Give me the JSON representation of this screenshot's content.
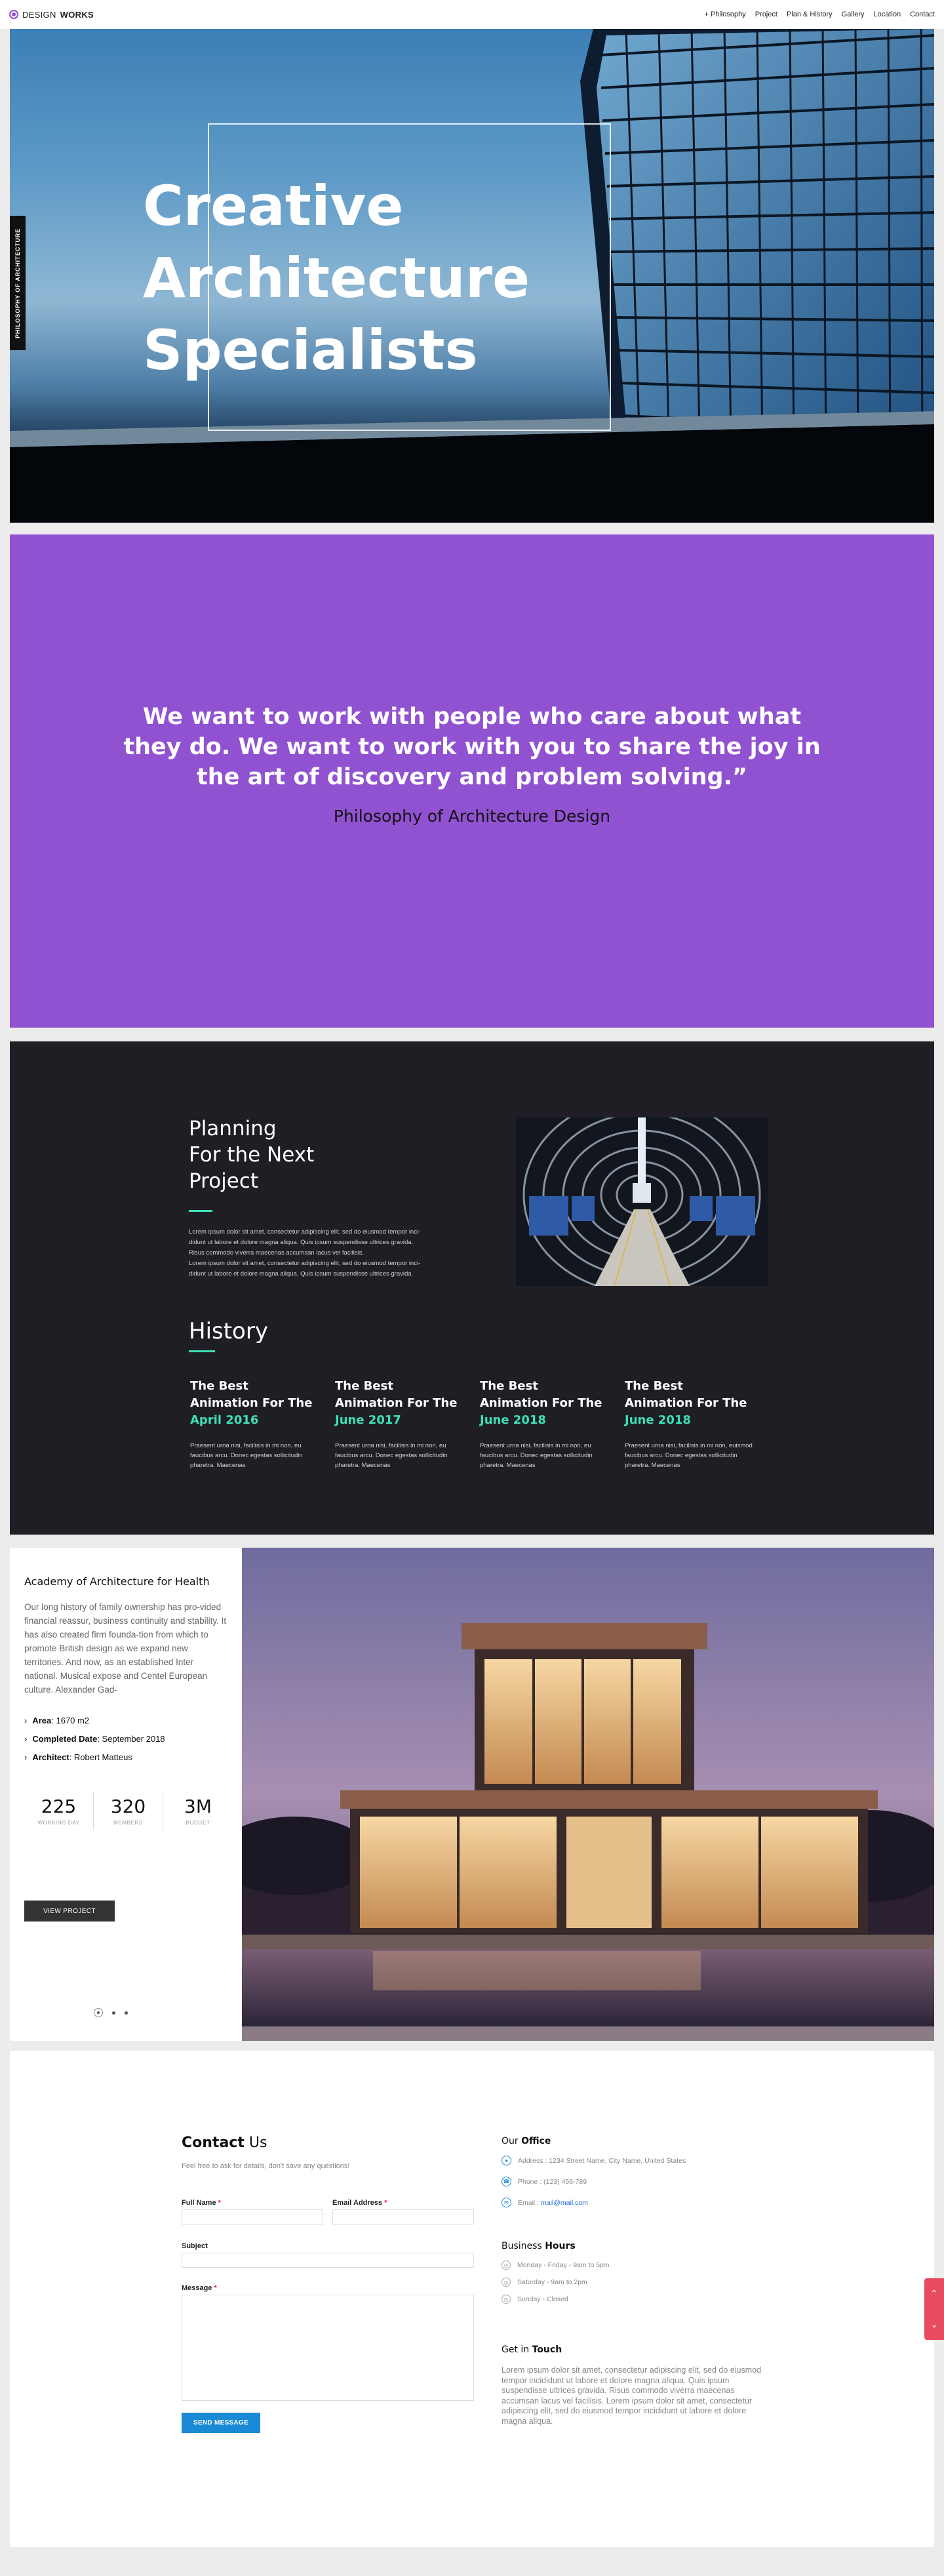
{
  "header": {
    "logo_light": "DESIGN",
    "logo_bold": "WORKS",
    "nav": [
      "+ Philosophy",
      "Project",
      "Plan & History",
      "Gallery",
      "Location",
      "Contact"
    ]
  },
  "hero": {
    "title": "Creative Architecture Specialists",
    "side_label": "PHILOSOPHY OF ARCHITECTURE"
  },
  "quote": {
    "text": "We want to work with people who care about what they do. We want to work with you to share the joy in the art of discovery and problem solving.”",
    "attribution": "Philosophy of Architecture Design"
  },
  "planning": {
    "title": "Planning\nFor the Next\nProject",
    "body": "Lorem ipsum dolor sit amet, consectetur adipiscing elit, sed do eiusmod tempor inci-\ndidunt ut labore et dolore magna aliqua. Quis ipsum suspendisse ultrices gravida.\nRisus commodo viverra maecenas accumsan lacus vel facilisis.\nLorem ipsum dolor sit amet, consectetur adipiscing elit, sed do eiusmod tempor inci-\ndidunt ut labore et dolore magna aliqua. Quis ipsum suspendisse ultrices gravida."
  },
  "history": {
    "title": "History",
    "items": [
      {
        "heading_1": "The Best",
        "heading_2": "Animation For The",
        "date": "April 2016",
        "body": "Praesent urna nisi, facilisis in mi non, eu faucibus arcu. Donec egestas sollicitudin pharetra. Maecenas"
      },
      {
        "heading_1": "The Best",
        "heading_2": "Animation For The",
        "date": "June 2017",
        "body": "Praesent urna nisi, facilisis in mi non, eu faucibus arcu. Donec egestas sollicitudin pharetra. Maecenas"
      },
      {
        "heading_1": "The Best",
        "heading_2": "Animation For The",
        "date": "June 2018",
        "body": "Praesent urna nisi, facilisis in mi non, eu faucibus arcu. Donec egestas sollicitudin pharetra. Maecenas"
      },
      {
        "heading_1": "The Best",
        "heading_2": "Animation For The",
        "date": "June 2018",
        "body": "Praesent urna nisi, facilisis in mi non, euismod faucibus arcu. Donec egestas sollicitudin pharetra. Maecenas"
      }
    ]
  },
  "project": {
    "title": "Academy of Architecture for Health",
    "description": "Our long history of family ownership has pro-vided financial reassur, business continuity and stability. It has also created firm founda-tion from which to promote British design as we expand new territories. And now, as an established Inter national. Musical expose and Centel European culture. Alexander Gad-",
    "specs": [
      {
        "label": "Area",
        "value": ": 1670 m2"
      },
      {
        "label": "Completed Date",
        "value": ": September 2018"
      },
      {
        "label": "Architect",
        "value": ": Robert Matteus"
      }
    ],
    "stats": [
      {
        "value": "225",
        "label": "WORKING DAY"
      },
      {
        "value": "320",
        "label": "MEMBERS"
      },
      {
        "value": "3M",
        "label": "BUDGET"
      }
    ],
    "button": "VIEW PROJECT"
  },
  "contact": {
    "title_bold": "Contact",
    "title_light": " Us",
    "subtitle": "Feel free to ask for details, don't save any questions!",
    "full_name_label": "Full Name",
    "email_label": "Email Address",
    "subject_label": "Subject",
    "message_label": "Message",
    "required_mark": "*",
    "send_button": "SEND MESSAGE",
    "office_title_light": "Our ",
    "office_title_bold": "Office",
    "address": "Address : 1234 Street Name, City Name, United States",
    "phone": "Phone : (123) 456-789",
    "email_prefix": "Email : ",
    "email": "mail@mail.com",
    "hours_title_light": "Business ",
    "hours_title_bold": "Hours",
    "hours": [
      "Monday - Friday - 9am to 5pm",
      "Saturday - 9am to 2pm",
      "Sunday - Closed"
    ],
    "touch_title_light": "Get in ",
    "touch_title_bold": "Touch",
    "touch_text": "Lorem ipsum dolor sit amet, consectetur adipiscing elit, sed do eiusmod tempor incididunt ut labore et dolore magna aliqua. Quis ipsum suspendisse ultrices gravida. Risus commodo viverra maecenas accumsan lacus vel facilisis. Lorem ipsum dolor sit amet, consectetur adipiscing elit, sed do eiusmod tempor incididunt ut labore et dolore magna aliqua."
  },
  "colors": {
    "accent_purple": "#9152d1",
    "accent_teal": "#3de0b5",
    "button_blue": "#1a8ad6",
    "scroll_red": "#e84a5f"
  }
}
